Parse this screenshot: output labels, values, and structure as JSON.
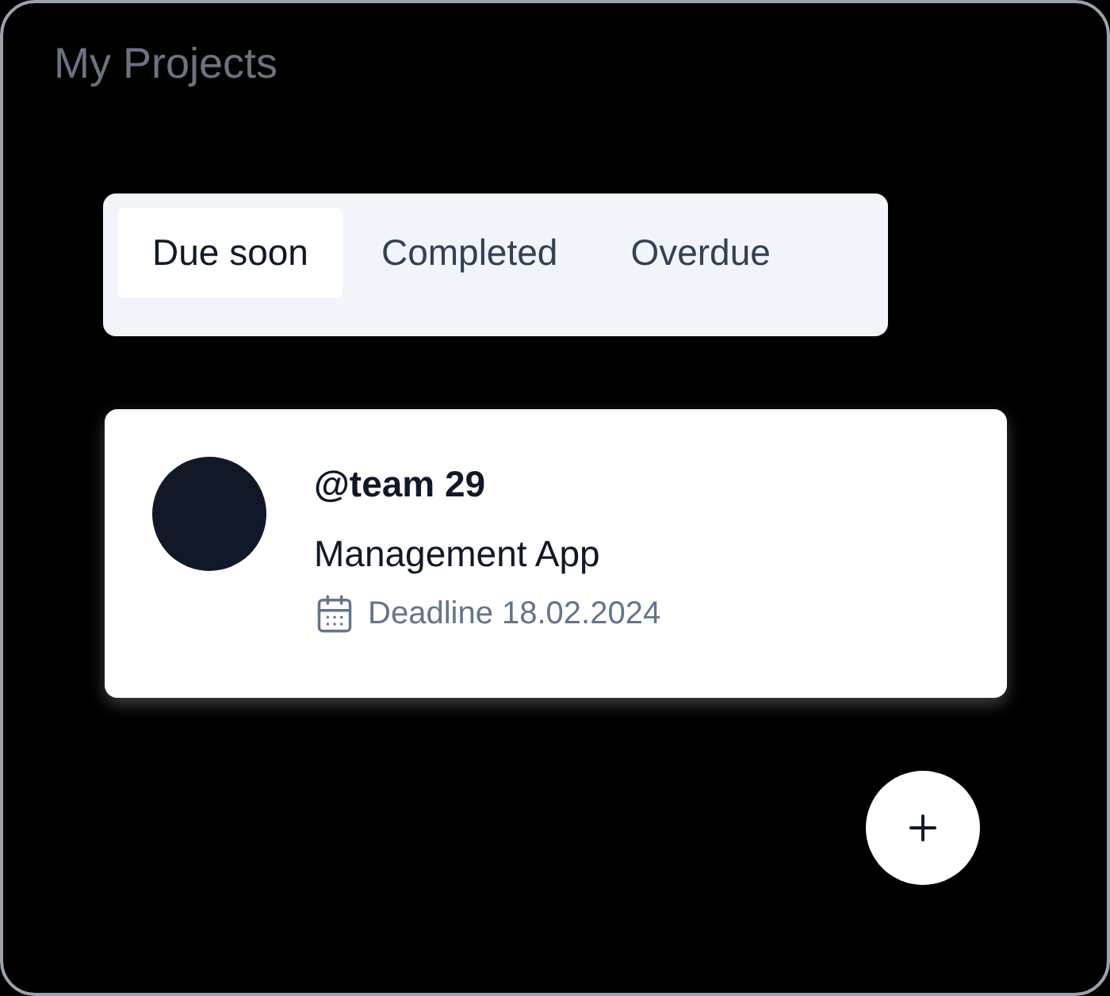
{
  "title": "My Projects",
  "tabs": [
    {
      "label": "Due soon",
      "selected": true
    },
    {
      "label": "Completed",
      "selected": false
    },
    {
      "label": "Overdue",
      "selected": false
    }
  ],
  "projects": [
    {
      "team": "@team 29",
      "name": "Management App",
      "deadline": "Deadline 18.02.2024"
    }
  ]
}
